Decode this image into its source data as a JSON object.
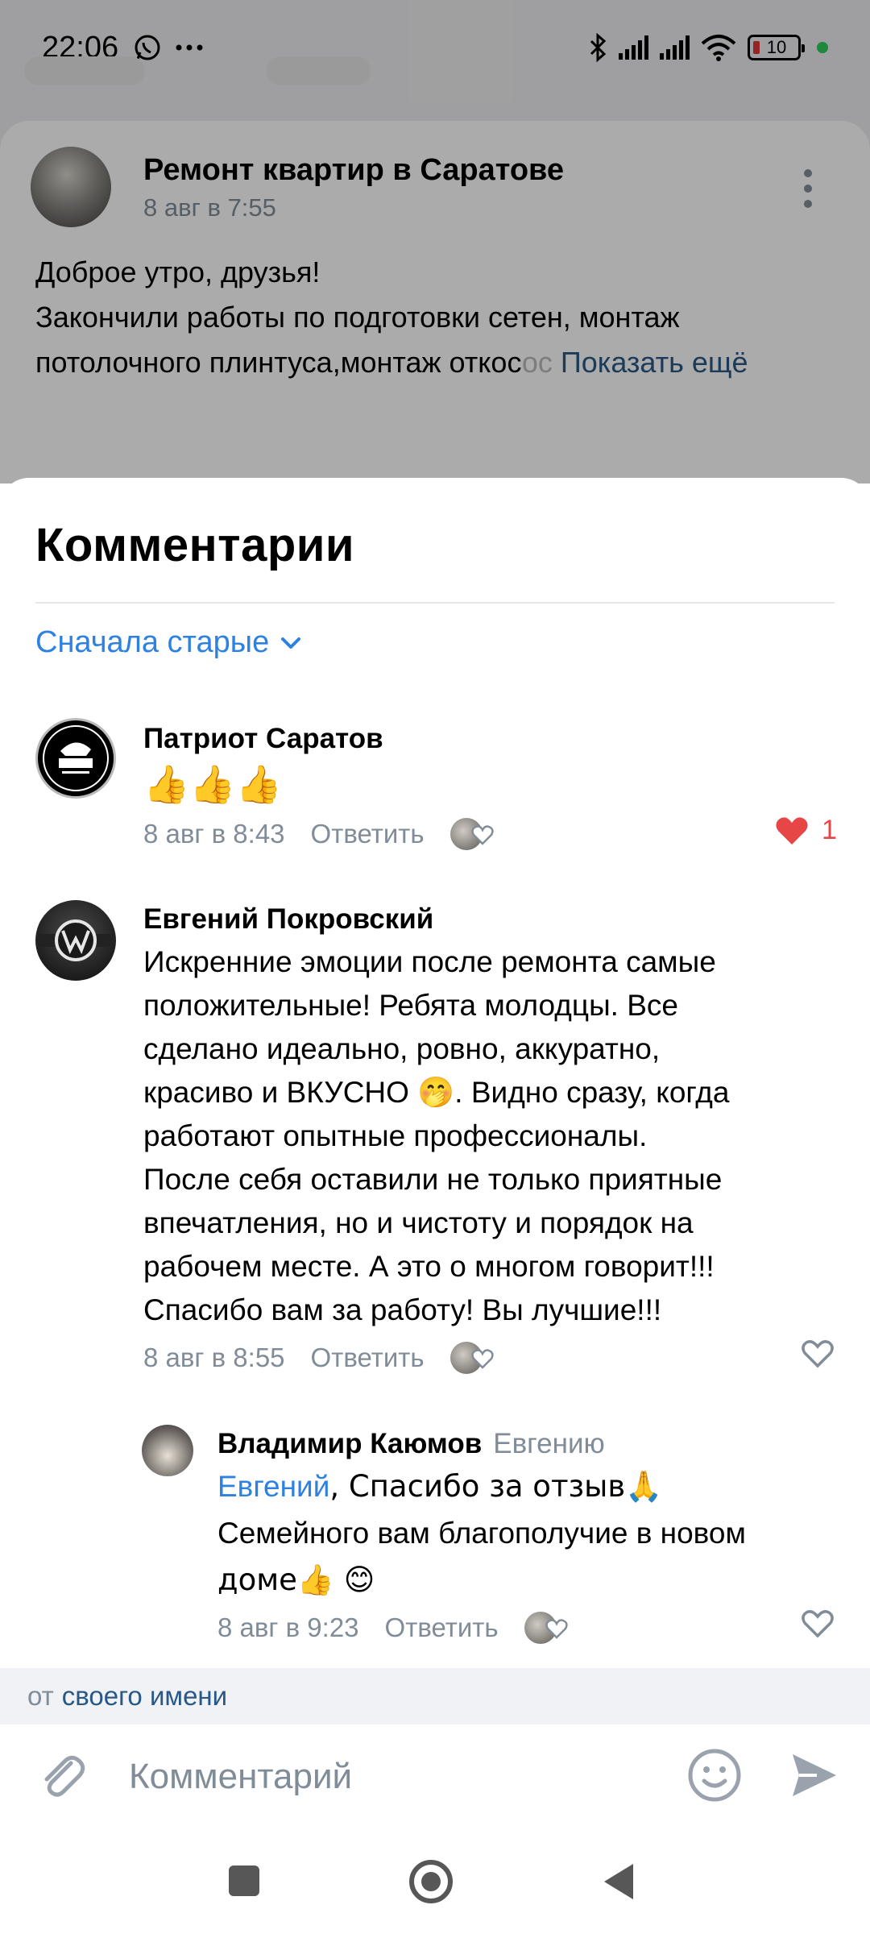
{
  "status_bar": {
    "time": "22:06",
    "battery": "10",
    "icons": [
      "whatsapp-icon",
      "more-dots-icon",
      "bluetooth-icon",
      "signal-icon",
      "signal-icon",
      "wifi-icon",
      "battery-icon"
    ]
  },
  "background_post": {
    "group_name": "Ремонт квартир в Саратове",
    "date": "8 авг в 7:55",
    "text_line1": "Доброе утро, друзья!",
    "text_line2": "Закончили работы по подготовки сетен, монтаж",
    "text_line3": "потолочного плинтуса,монтаж откос",
    "show_more": "Показать ещё"
  },
  "sheet": {
    "title": "Комментарии",
    "sort_label": "Сначала старые"
  },
  "comments": [
    {
      "author": "Патриот Саратов",
      "text": "👍👍👍",
      "date": "8 авг в 8:43",
      "reply_label": "Ответить",
      "likes": "1",
      "liked": true
    },
    {
      "author": "Евгений Покровский",
      "lines": [
        "Искренние эмоции после ремонта самые",
        "положительные! Ребята молодцы. Все",
        "сделано идеально, ровно, аккуратно,",
        "красиво и ВКУСНО",
        ". Видно сразу, когда",
        "работают опытные профессионалы.",
        "После себя оставили не только приятные",
        "впечатления, но и чистоту и порядок на",
        "рабочем месте. А это о многом говорит!!!",
        "Спасибо вам за работу! Вы лучшие!!!"
      ],
      "date": "8 авг в 8:55",
      "reply_label": "Ответить",
      "liked": false
    },
    {
      "author": "Владимир Каюмов",
      "reply_to": "Евгению",
      "mention": "Евгений",
      "line1": ", Спасибо за отзыв🙏",
      "line2": "Семейного вам благополучие в новом",
      "line3": "доме👍 😊",
      "date": "8 авг в 9:23",
      "reply_label": "Ответить",
      "liked": false
    }
  ],
  "composer": {
    "from_prefix": "от",
    "from_name": "своего имени",
    "placeholder": "Комментарий"
  },
  "colors": {
    "accent": "#2d81e0",
    "link_dark": "#2a5885",
    "secondary_text": "#818c99",
    "like_red": "#e64646"
  }
}
